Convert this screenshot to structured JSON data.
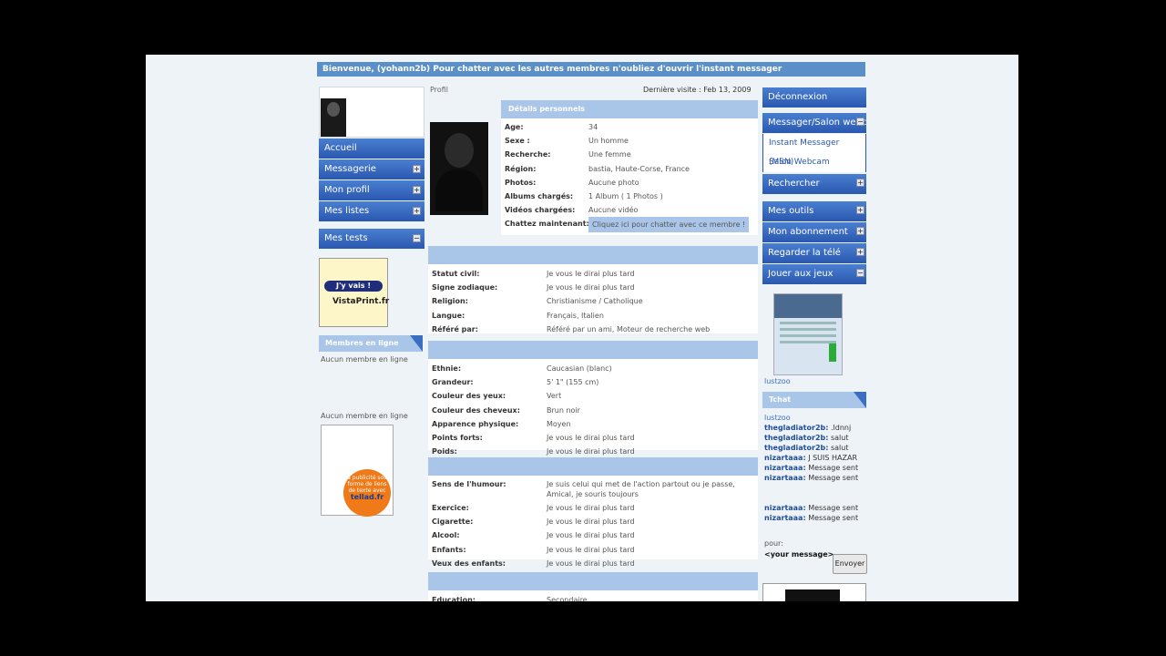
{
  "welcome": "Bienvenue,    (yohann2b) Pour chatter avec les autres membres n'oubliez d'ouvrir l'instant messager",
  "left_nav": [
    {
      "label": "Accueil",
      "plus": false
    },
    {
      "label": "Messagerie",
      "plus": true
    },
    {
      "label": "Mon profil",
      "plus": true
    },
    {
      "label": "Mes listes",
      "plus": true
    },
    {
      "label": "Mes tests",
      "plus": true
    }
  ],
  "ad1": {
    "button": "J'y vais !",
    "brand": "VistaPrint.fr"
  },
  "members_online": {
    "title": "Membres en ligne",
    "empty1": "Aucun membre en ligne",
    "empty2": "Aucun membre en ligne"
  },
  "ad2": {
    "text": "La publicité sous forme de liens de texte avec",
    "brand": "tellad.fr"
  },
  "profile_label": "Profil",
  "last_visit": "Dernière visite :  Feb 13, 2009",
  "personal": {
    "title": "Détails personnels",
    "rows": [
      {
        "k": "Age:",
        "v": "34"
      },
      {
        "k": "Sexe :",
        "v": "Un homme"
      },
      {
        "k": "Recherche:",
        "v": "Une femme"
      },
      {
        "k": "Région:",
        "v": "bastia,  Haute-Corse,  France"
      },
      {
        "k": "Photos:",
        "v": "Aucune photo"
      },
      {
        "k": "Albums chargés:",
        "v": "1 Album ( 1 Photos )"
      },
      {
        "k": "Vidéos chargées:",
        "v": "Aucune vidéo"
      },
      {
        "k": "Chattez maintenant:",
        "v": "Cliquez ici pour chatter avec ce membre !"
      }
    ]
  },
  "section1": [
    {
      "k": "Statut civil:",
      "v": "Je vous le dirai plus tard"
    },
    {
      "k": "Signe zodiaque:",
      "v": "Je vous le dirai plus tard"
    },
    {
      "k": "Religion:",
      "v": "Christianisme / Catholique"
    },
    {
      "k": "Langue:",
      "v": "Français, Italien"
    },
    {
      "k": "Référé par:",
      "v": "Référé par un ami, Moteur de recherche web"
    }
  ],
  "section2": [
    {
      "k": "Ethnie:",
      "v": "Caucasian (blanc)"
    },
    {
      "k": "Grandeur:",
      "v": "5' 1\" (155 cm)"
    },
    {
      "k": "Couleur des yeux:",
      "v": "Vert"
    },
    {
      "k": "Couleur des cheveux:",
      "v": "Brun noir"
    },
    {
      "k": "Apparence physique:",
      "v": "Moyen"
    },
    {
      "k": "Points forts:",
      "v": "Je vous le dirai plus tard"
    },
    {
      "k": "Poids:",
      "v": "Je vous le dirai plus tard"
    }
  ],
  "section3": [
    {
      "k": "Sens de l'humour:",
      "v": "Je suis celui qui met de l'action partout ou je passe,",
      "v2": "Amical, je souris toujours"
    },
    {
      "k": "Exercice:",
      "v": "Je vous le dirai plus tard"
    },
    {
      "k": "Cigarette:",
      "v": "Je vous le dirai plus tard"
    },
    {
      "k": "Alcool:",
      "v": "Je vous le dirai plus tard"
    },
    {
      "k": "Enfants:",
      "v": "Je vous le dirai plus tard"
    },
    {
      "k": "Veux des enfants:",
      "v": "Je vous le dirai plus tard"
    }
  ],
  "section4": [
    {
      "k": "Education:",
      "v": "Secondaire"
    }
  ],
  "right_nav": {
    "deconnexion": "Déconnexion",
    "messager": "Messager/Salon webcam",
    "msn": "Instant Messager (MSN)",
    "webcam": "Salon Webcam",
    "rechercher": "Rechercher",
    "outils": "Mes outils",
    "abonnement": "Mon abonnement",
    "tele": "Regarder la télé",
    "jeux": "Jouer aux jeux"
  },
  "tchat": {
    "title": "Tchat",
    "pre": "lustzoo",
    "messages": [
      {
        "u": "thegladiator2b:",
        "m": " .ldnnj"
      },
      {
        "u": "thegladiator2b:",
        "m": " salut"
      },
      {
        "u": "thegladiator2b:",
        "m": " salut"
      },
      {
        "u": "nizartaaa:",
        "m": " J SUIS HAZAR"
      },
      {
        "u": "nizartaaa:",
        "m": " Message sent"
      },
      {
        "u": "nizartaaa:",
        "m": " Message sent"
      },
      {
        "u": "",
        "m": ""
      },
      {
        "u": "",
        "m": ""
      },
      {
        "u": "nizartaaa:",
        "m": " Message sent"
      },
      {
        "u": "nizartaaa:",
        "m": " Message sent"
      }
    ],
    "pour": "pour:",
    "placeholder": "<your message>",
    "send": "Envoyer"
  }
}
